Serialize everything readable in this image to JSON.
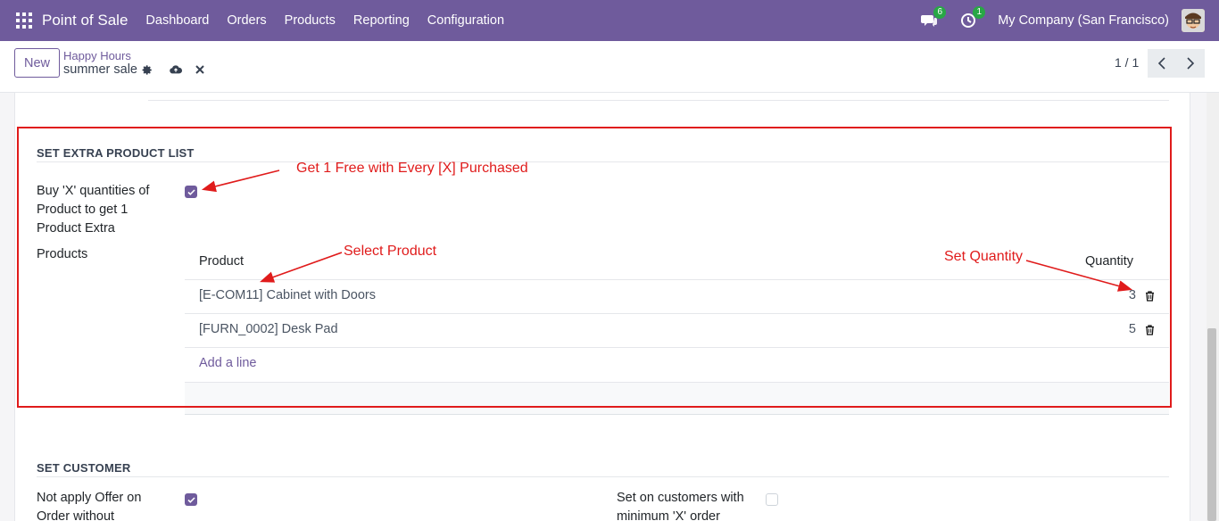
{
  "navbar": {
    "app_name": "Point of Sale",
    "menu": [
      "Dashboard",
      "Orders",
      "Products",
      "Reporting",
      "Configuration"
    ],
    "messages_count": "6",
    "activities_count": "1",
    "company": "My Company (San Francisco)"
  },
  "control_panel": {
    "new_label": "New",
    "breadcrumb_parent": "Happy Hours",
    "record_name": "summer sale",
    "pager": "1 / 1"
  },
  "extra_product_section": {
    "title": "SET EXTRA PRODUCT LIST",
    "buy_x_label": "Buy 'X' quantities of Product to get 1 Product Extra",
    "buy_x_checked": true,
    "products_label": "Products",
    "columns": {
      "product": "Product",
      "quantity": "Quantity"
    },
    "rows": [
      {
        "product": "[E-COM11] Cabinet with Doors",
        "quantity": "3"
      },
      {
        "product": "[FURN_0002] Desk Pad",
        "quantity": "5"
      }
    ],
    "add_line": "Add a line"
  },
  "customer_section": {
    "title": "SET CUSTOMER",
    "not_apply_label": "Not apply Offer on Order without",
    "not_apply_checked": true,
    "set_on_customers_label": "Set on customers with minimum 'X' order",
    "set_on_customers_checked": false
  },
  "annotations": {
    "free_note": "Get 1 Free with Every [X] Purchased",
    "select_product": "Select Product",
    "set_quantity": "Set Quantity"
  },
  "colors": {
    "navbar": "#6f5b9c",
    "accent": "#6f5b9c",
    "annotation": "#e01b1b",
    "badge": "#28a745"
  }
}
